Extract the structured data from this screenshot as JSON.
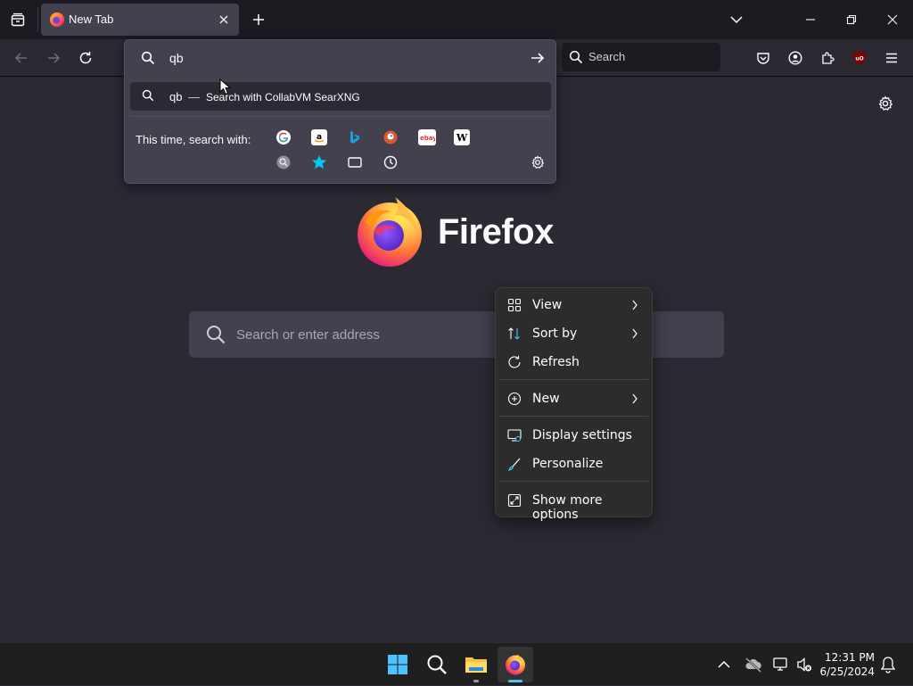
{
  "browser": {
    "tab": {
      "title": "New Tab",
      "favicon": "firefox-icon"
    },
    "toolbar": {
      "search_placeholder": "Search",
      "icons": [
        "back-icon",
        "forward-icon",
        "reload-icon",
        "pocket-icon",
        "account-icon",
        "extensions-icon",
        "ublock-icon",
        "menu-icon"
      ]
    },
    "window_controls": [
      "minimize-icon",
      "restore-icon",
      "close-icon"
    ]
  },
  "urlbar": {
    "query": "qb",
    "result": {
      "query": "qb",
      "separator": "—",
      "action": "Search with CollabVM SearXNG"
    },
    "oneoff_label": "This time, search with:",
    "engines": [
      "Google",
      "Amazon",
      "Bing",
      "DuckDuckGo",
      "eBay",
      "Wikipedia",
      "CollabVM SearXNG"
    ],
    "ebay_text": "ebay",
    "wikipedia_text": "W",
    "modes": [
      "bookmarks",
      "tabs",
      "history"
    ]
  },
  "newtab": {
    "wordmark": "Firefox",
    "search_placeholder": "Search or enter address"
  },
  "context_menu": {
    "items": [
      {
        "label": "View",
        "icon": "grid-icon",
        "submenu": true
      },
      {
        "label": "Sort by",
        "icon": "sort-icon",
        "submenu": true
      },
      {
        "label": "Refresh",
        "icon": "refresh-icon",
        "submenu": false
      },
      {
        "label": "New",
        "icon": "plus-circle-icon",
        "submenu": true
      },
      {
        "label": "Display settings",
        "icon": "display-icon",
        "submenu": false
      },
      {
        "label": "Personalize",
        "icon": "brush-icon",
        "submenu": false
      },
      {
        "label": "Show more options",
        "icon": "expand-icon",
        "submenu": false
      }
    ]
  },
  "taskbar": {
    "clock": {
      "time": "12:31 PM",
      "date": "6/25/2024"
    },
    "apps": [
      "start",
      "search",
      "file-explorer",
      "firefox"
    ]
  },
  "colors": {
    "tab_strip": "#1c1b22",
    "toolbar": "#2b2a33",
    "popup": "#42414d",
    "accent": "#00ddff",
    "taskbar": "#1f1f1f"
  }
}
